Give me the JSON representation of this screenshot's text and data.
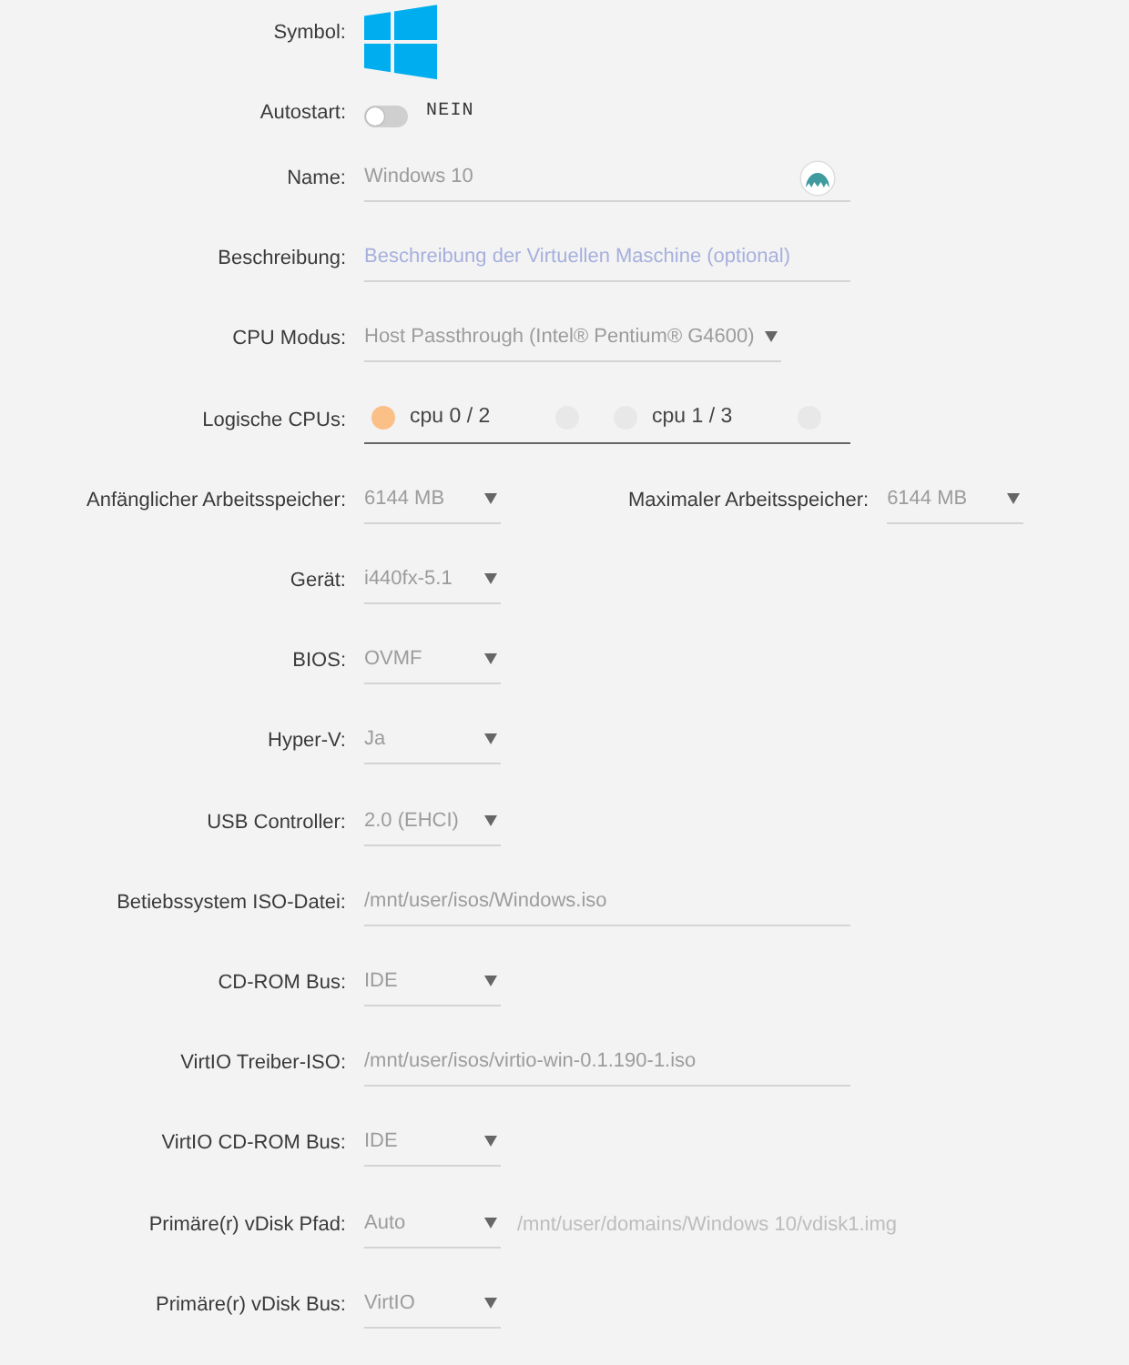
{
  "symbol": {
    "label": "Symbol:"
  },
  "autostart": {
    "label": "Autostart:",
    "on": false,
    "state_text": "NEIN"
  },
  "rows": [
    {
      "kind": "icon_input",
      "label": "Name:",
      "value": "Windows 10"
    },
    {
      "kind": "input",
      "label": "Beschreibung:",
      "placeholder": "Beschreibung der Virtuellen Maschine (optional)"
    },
    {
      "kind": "select",
      "label": "CPU Modus:",
      "value": "Host Passthrough (Intel® Pentium® G4600)"
    },
    {
      "kind": "cpus",
      "label": "Logische CPUs:",
      "cpus": [
        {
          "label": "cpu 0 / 2",
          "threads": [
            {
              "checked": true
            },
            {
              "checked": false
            }
          ]
        },
        {
          "label": "cpu 1 / 3",
          "threads": [
            {
              "checked": false
            },
            {
              "checked": false
            }
          ]
        }
      ]
    },
    {
      "kind": "select_pair",
      "label": "Anfänglicher Arbeitsspeicher:",
      "value": "6144 MB",
      "second_label": "Maximaler Arbeitsspeicher:",
      "second_value": "6144 MB"
    },
    {
      "kind": "select",
      "label": "Gerät:",
      "value": "i440fx-5.1"
    },
    {
      "kind": "select",
      "label": "BIOS:",
      "value": "OVMF"
    },
    {
      "kind": "select",
      "label": "Hyper-V:",
      "value": "Ja"
    },
    {
      "kind": "select",
      "label": "USB Controller:",
      "value": "2.0 (EHCI)"
    },
    {
      "kind": "input",
      "label": "Betiebssystem ISO-Datei:",
      "value": "/mnt/user/isos/Windows.iso"
    },
    {
      "kind": "select",
      "label": "CD-ROM Bus:",
      "value": "IDE"
    },
    {
      "kind": "input",
      "label": "VirtIO Treiber-ISO:",
      "value": "/mnt/user/isos/virtio-win-0.1.190-1.iso"
    },
    {
      "kind": "select",
      "label": "VirtIO CD-ROM Bus:",
      "value": "IDE"
    },
    {
      "kind": "select_path",
      "label": "Primäre(r) vDisk Pfad:",
      "value": "Auto",
      "path": "/mnt/user/domains/Windows 10/vdisk1.img"
    },
    {
      "kind": "select",
      "label": "Primäre(r) vDisk Bus:",
      "value": "VirtIO"
    }
  ]
}
